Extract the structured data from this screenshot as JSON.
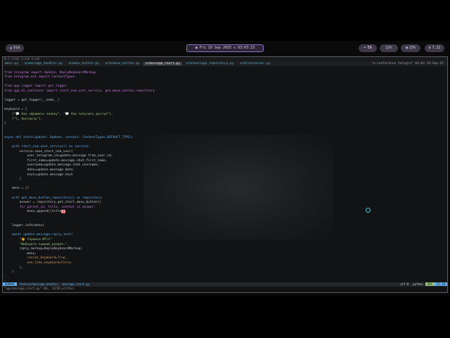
{
  "topbar": {
    "left_pill": "Vim",
    "left_pill_icon": "▲",
    "date": "Fri 19 Sep 2025",
    "time": "03:03:23",
    "lang": "EN",
    "cpu": "22%",
    "mem": "25%",
    "battery": "7.22"
  },
  "tmux": {
    "line": "0:1 [vim] 2:zsh 3:zsh"
  },
  "tabs": {
    "items": [
      "main.py",
      "a/message_handler.py",
      "a/menu_button.py",
      "a/m/menu_button.py"
    ],
    "active": "a/message_start.py",
    "after": [
      "a/m/message_repository.py",
      "a/d/container.py"
    ],
    "right": "\"a:conference telegra\" 03:03 19-Sep-25"
  },
  "code": {
    "l01": "from telegram import Update, ReplyKeyboardMarkup",
    "l02": "from telegram.ext import ContextTypes",
    "l03": "",
    "l04": "from app.logger import get_logger",
    "l05": "from app.di.container import start_osm_user_service, get_menu_button_repository",
    "l06": "",
    "l07": "logger = get_logger(__name__)",
    "l08": "",
    "l09": "keyboard = [",
    "l10": "    [\"💬 Как оформить заявку\", \"💬 Как получить доступ\"],",
    "l11": "    [\"📞 Контакты\"],",
    "l12": "]",
    "l13": "",
    "l14": "",
    "l15": "async def start(update: Update, context: ContextTypes.DEFAULT_TYPE):",
    "l16": "",
    "l17": "    with start_osm_user_service() as service:",
    "l18": "        service.save_start_osm_user(",
    "l19": "            user_telegram_id=update.message.from_user.id,",
    "l20": "            first_name=update.message.chat.first_name,",
    "l21": "            username=update.message.chat.username,",
    "l22": "            date=update.message.date,",
    "l23": "            text=update.message.text",
    "l24": "        )",
    "l25": "",
    "l26": "    menu = []",
    "l27": "",
    "l28": "    with get_menu_button_repository() as repository:",
    "l29": "        answer = repository.get_start_menu_button()",
    "l30": "        for parent_id, title, context in answer:",
    "l31_a": "            menu.append(",
    "l31_b": "[",
    "l31_c": "title",
    "l31_d": "])",
    "l32": "",
    "l33": "",
    "l34": "    logger.info(menu)",
    "l35": "",
    "l36": "    await update.message.reply_text(",
    "l37": "        \"👋 Сервисы ИТ\\n\"",
    "l38": "        \"Выберите нужный раздел:\",",
    "l39": "        reply_markup=ReplyKeyboardMarkup(",
    "l40": "            menu,",
    "l41": "            resize_keyboard=True,",
    "l42": "            one_time_keyboard=False,",
    "l43": "        ),",
    "l44": "    )",
    "l45": "~",
    "l46": "~"
  },
  "statusline": {
    "mode": "NORMAL",
    "branch": "feature/message_handler",
    "file": "message_start.py",
    "encoding": "utf-8",
    "format": "python",
    "percent": "49%",
    "position": "31:18"
  },
  "cmdline": "\"app/message_start.py\" 44L, 1321B written",
  "colors": {
    "accent": "#8c72c8",
    "vim_blue": "#61afef",
    "vim_green": "#98c379"
  }
}
